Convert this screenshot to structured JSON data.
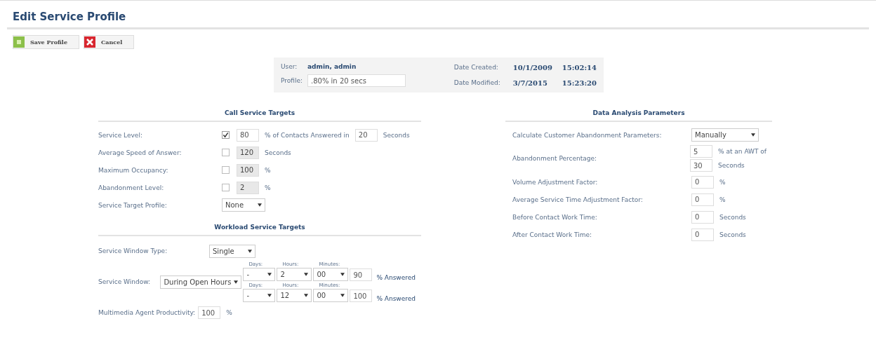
{
  "title": "Edit Service Profile",
  "toolbar": [
    {
      "kind": "save",
      "label": "Save Profile"
    },
    {
      "kind": "cancel",
      "label": "Cancel"
    }
  ],
  "info": {
    "user_label": "User:",
    "user": "admin, admin",
    "profile_label": "Profile:",
    "profile": ".80% in 20 secs",
    "created_label": "Date Created:",
    "created_date": "10/1/2009",
    "created_time": "15:02:14",
    "modified_label": "Date Modified:",
    "modified_date": "3/7/2015",
    "modified_time": "15:23:20"
  },
  "call_service_targets": {
    "title": "Call Service Targets",
    "rows": [
      {
        "label": "Service Level:",
        "checked": true,
        "value": "80",
        "unit": "% of Contacts Answered in",
        "extra_value": "20",
        "extra_unit": "Seconds"
      },
      {
        "label": "Average Speed of Answer:",
        "checked": false,
        "value": "120",
        "unit": "Seconds"
      },
      {
        "label": "Maximum Occupancy:",
        "checked": false,
        "value": "100",
        "unit": "%"
      },
      {
        "label": "Abandonment Level:",
        "checked": false,
        "value": "2",
        "unit": "%"
      }
    ],
    "target_profile": {
      "label": "Service Target Profile:",
      "value": "None"
    }
  },
  "workload_service_targets": {
    "title": "Workload Service Targets",
    "window_type": {
      "label": "Service Window Type:",
      "value": "Single"
    },
    "service_window": {
      "label": "Service Window:",
      "value": "During Open Hours",
      "rows": [
        {
          "days_label": "Days:",
          "hours_label": "Hours:",
          "minutes_label": "Minutes:",
          "unit": "% Answered",
          "days": "-",
          "hours": "2",
          "minutes": "00",
          "percent": "90"
        },
        {
          "days_label": "Days:",
          "hours_label": "Hours:",
          "minutes_label": "Minutes:",
          "unit": "% Answered",
          "days": "-",
          "hours": "12",
          "minutes": "00",
          "percent": "100"
        }
      ]
    },
    "productivity": {
      "label": "Multimedia Agent Productivity:",
      "value": "100",
      "unit": "%"
    }
  },
  "data_analysis_parameters": {
    "title": "Data Analysis Parameters",
    "calculate": {
      "label": "Calculate Customer Abandonment Parameters:",
      "value": "Manually"
    },
    "abandonment": {
      "label": "Abandonment Percentage:",
      "percent": "5",
      "percent_unit": "% at an AWT of",
      "awt": "30",
      "awt_unit": "Seconds"
    },
    "rows": [
      {
        "label": "Volume Adjustment Factor:",
        "value": "0",
        "unit": "%"
      },
      {
        "label": "Average Service Time Adjustment Factor:",
        "value": "0",
        "unit": "%"
      },
      {
        "label": "Before Contact Work Time:",
        "value": "0",
        "unit": "Seconds"
      },
      {
        "label": "After Contact Work Time:",
        "value": "0",
        "unit": "Seconds"
      }
    ]
  }
}
